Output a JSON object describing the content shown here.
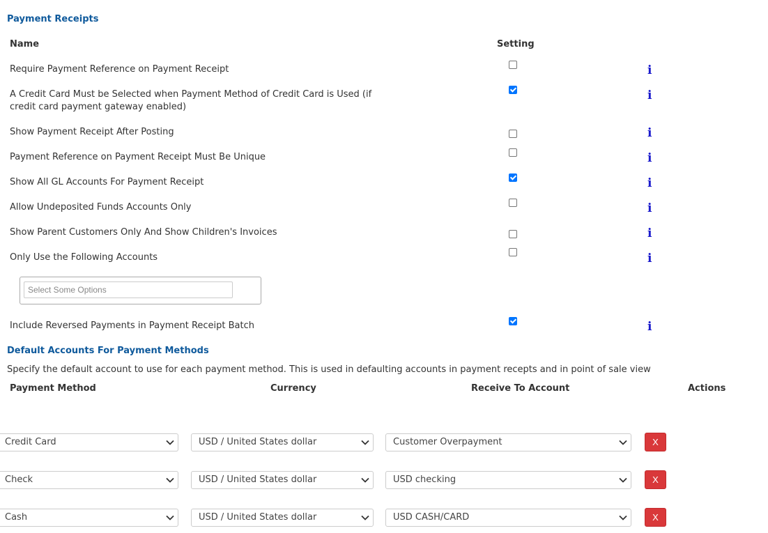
{
  "payment_receipts": {
    "title": "Payment Receipts",
    "col_name": "Name",
    "col_setting": "Setting",
    "settings": [
      {
        "label": "Require Payment Reference on Payment Receipt",
        "checked": false,
        "info": "i"
      },
      {
        "label": "A Credit Card Must be Selected when Payment Method of Credit Card is Used (if credit card payment gateway enabled)",
        "checked": true,
        "info": "i"
      },
      {
        "label": "Show Payment Receipt After Posting",
        "checked": false,
        "info": "i"
      },
      {
        "label": "Payment Reference on Payment Receipt Must Be Unique",
        "checked": false,
        "info": "i"
      },
      {
        "label": "Show All GL Accounts For Payment Receipt",
        "checked": true,
        "info": "i"
      },
      {
        "label": "Allow Undeposited Funds Accounts Only",
        "checked": false,
        "info": "i"
      },
      {
        "label": "Show Parent Customers Only And Show Children's Invoices",
        "checked": false,
        "info": "i"
      },
      {
        "label": "Only Use the Following Accounts",
        "checked": false,
        "info": "i"
      },
      {
        "label": "Include Reversed Payments in Payment Receipt Batch",
        "checked": true,
        "info": "i"
      }
    ],
    "accounts_placeholder": "Select Some Options"
  },
  "default_accounts": {
    "title": "Default Accounts For Payment Methods",
    "description": "Specify the default account to use for each payment method. This is used in defaulting accounts in payment recepts and in point of sale view",
    "col_method": "Payment Method",
    "col_currency": "Currency",
    "col_account": "Receive To Account",
    "col_actions": "Actions",
    "rows": [
      {
        "method": "Credit Card",
        "currency": "USD / United States dollar",
        "account": "Customer Overpayment",
        "delete": "X"
      },
      {
        "method": "Check",
        "currency": "USD / United States dollar",
        "account": "USD checking",
        "delete": "X"
      },
      {
        "method": "Cash",
        "currency": "USD / United States dollar",
        "account": "USD CASH/CARD",
        "delete": "X"
      }
    ]
  },
  "colors": {
    "section_title": "#0f5a9c",
    "checkbox_checked": "#0075ff",
    "info_icon": "#1a1acc",
    "delete_button": "#d9383a"
  }
}
